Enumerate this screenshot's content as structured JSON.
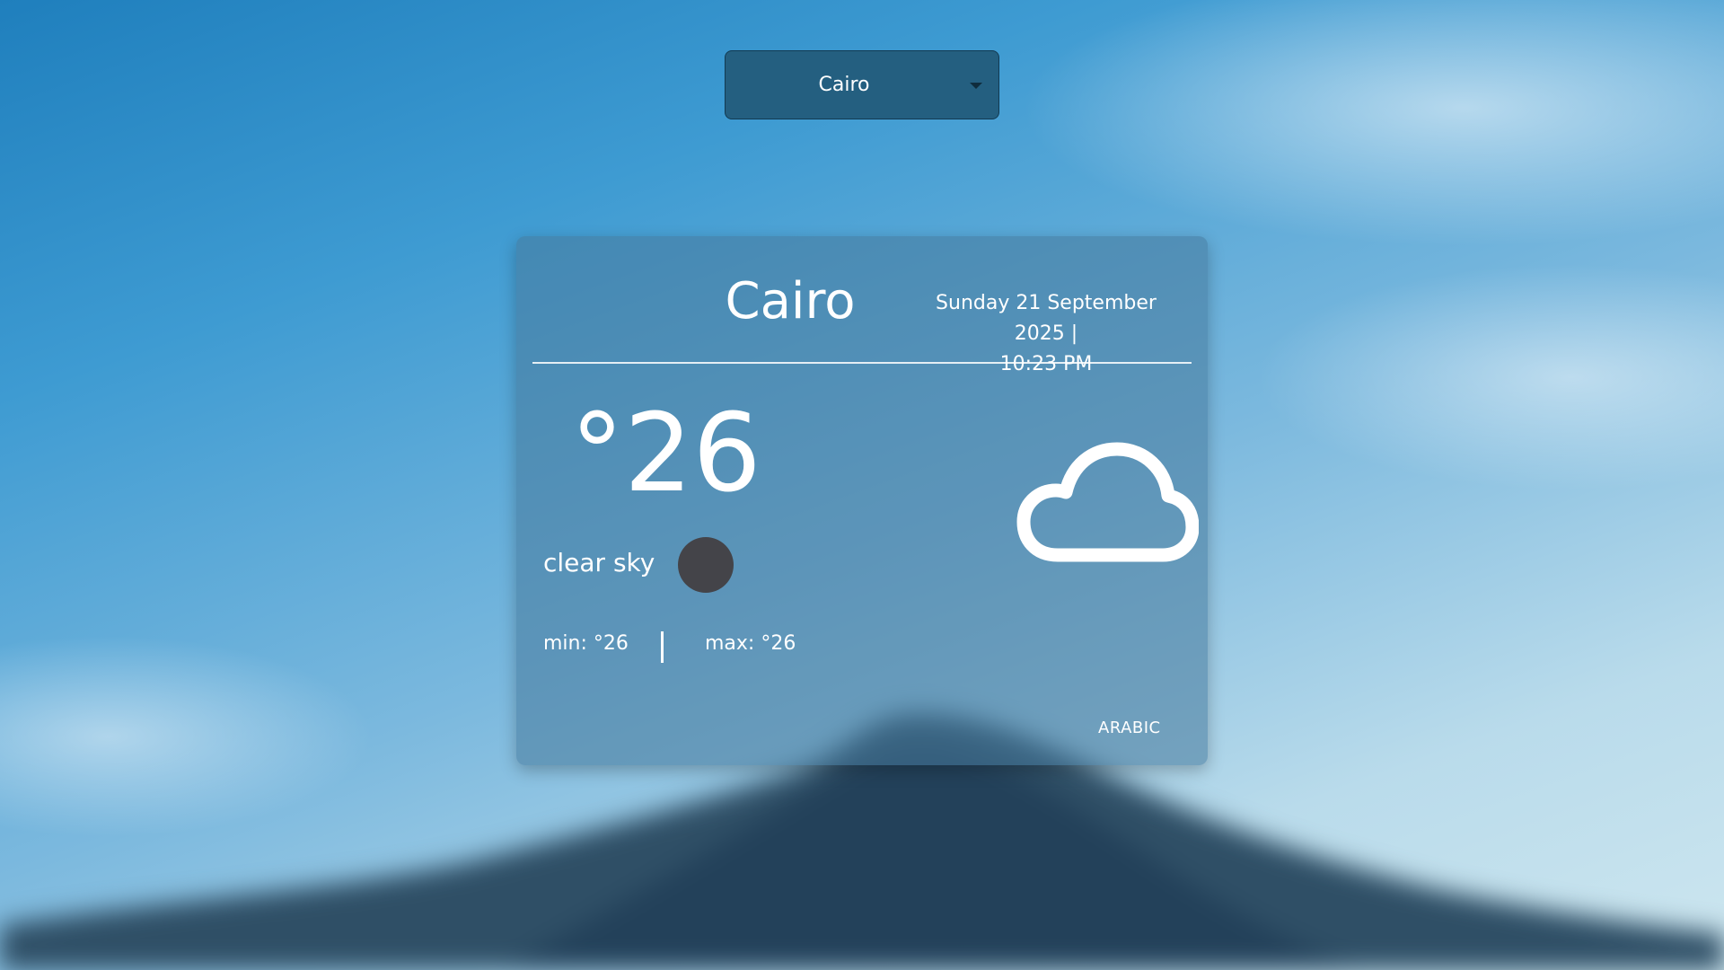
{
  "city_select": {
    "value": "Cairo",
    "icon": "chevron-down-icon"
  },
  "card": {
    "city": "Cairo",
    "date": "Sunday 21 September 2025 |",
    "time": "10:23 PM",
    "temperature": "°26",
    "description": "clear sky",
    "min_label": "min: °26",
    "max_label": "max: °26",
    "language_button": "ARABIC",
    "weather_icon": "cloud-icon"
  },
  "colors": {
    "select_bg": "#245f80",
    "card_bg": "rgba(70,120,155,0.55)",
    "text": "#ffffff",
    "desc_dot": "#444449"
  }
}
